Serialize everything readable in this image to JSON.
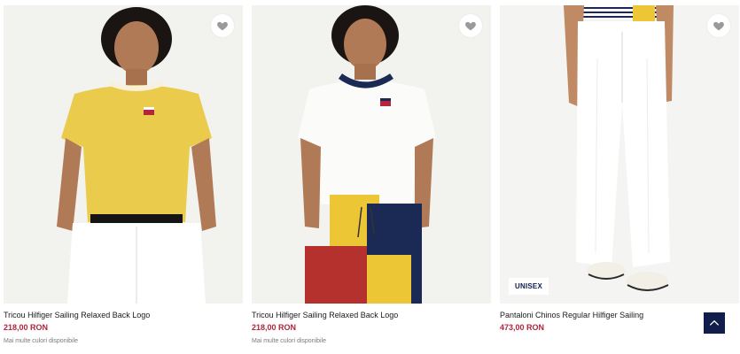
{
  "products": [
    {
      "title": "Tricou Hilfiger Sailing Relaxed Back Logo",
      "price": "218,00 RON",
      "colors_note": "Mai multe culori disponibile"
    },
    {
      "title": "Tricou Hilfiger Sailing Relaxed Back Logo",
      "price": "218,00 RON",
      "colors_note": "Mai multe culori disponibile"
    },
    {
      "title": "Pantaloni Chinos Regular Hilfiger Sailing",
      "price": "473,00 RON",
      "badge": "UNISEX"
    }
  ],
  "icons": {
    "favorite": "heart-icon",
    "scroll_top": "chevron-up-icon"
  },
  "colors": {
    "price": "#b3243d",
    "navy": "#111d4a",
    "photo_bg": "#f3f3f1"
  }
}
